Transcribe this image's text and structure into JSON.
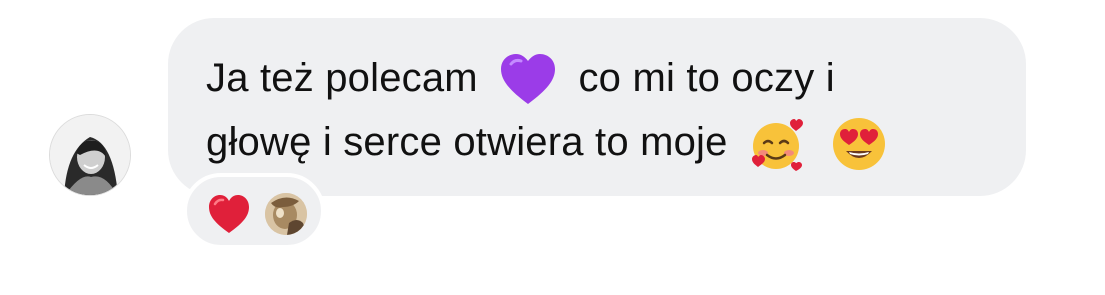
{
  "message": {
    "line1_part1": "Ja też polecam",
    "line1_part2": "co mi to oczy i",
    "line2_part1": "głowę i serce otwiera to moje"
  },
  "icons": {
    "inline_heart": "purple-heart-icon",
    "inline_face1": "smiling-face-with-hearts-icon",
    "inline_face2": "heart-eyes-icon",
    "reaction": "red-heart-icon"
  },
  "colors": {
    "bubble": "#eff0f2",
    "text": "#111111",
    "purple_heart": "#9b3ce8",
    "red_heart": "#e0203a",
    "face_yellow": "#f8c23a"
  }
}
